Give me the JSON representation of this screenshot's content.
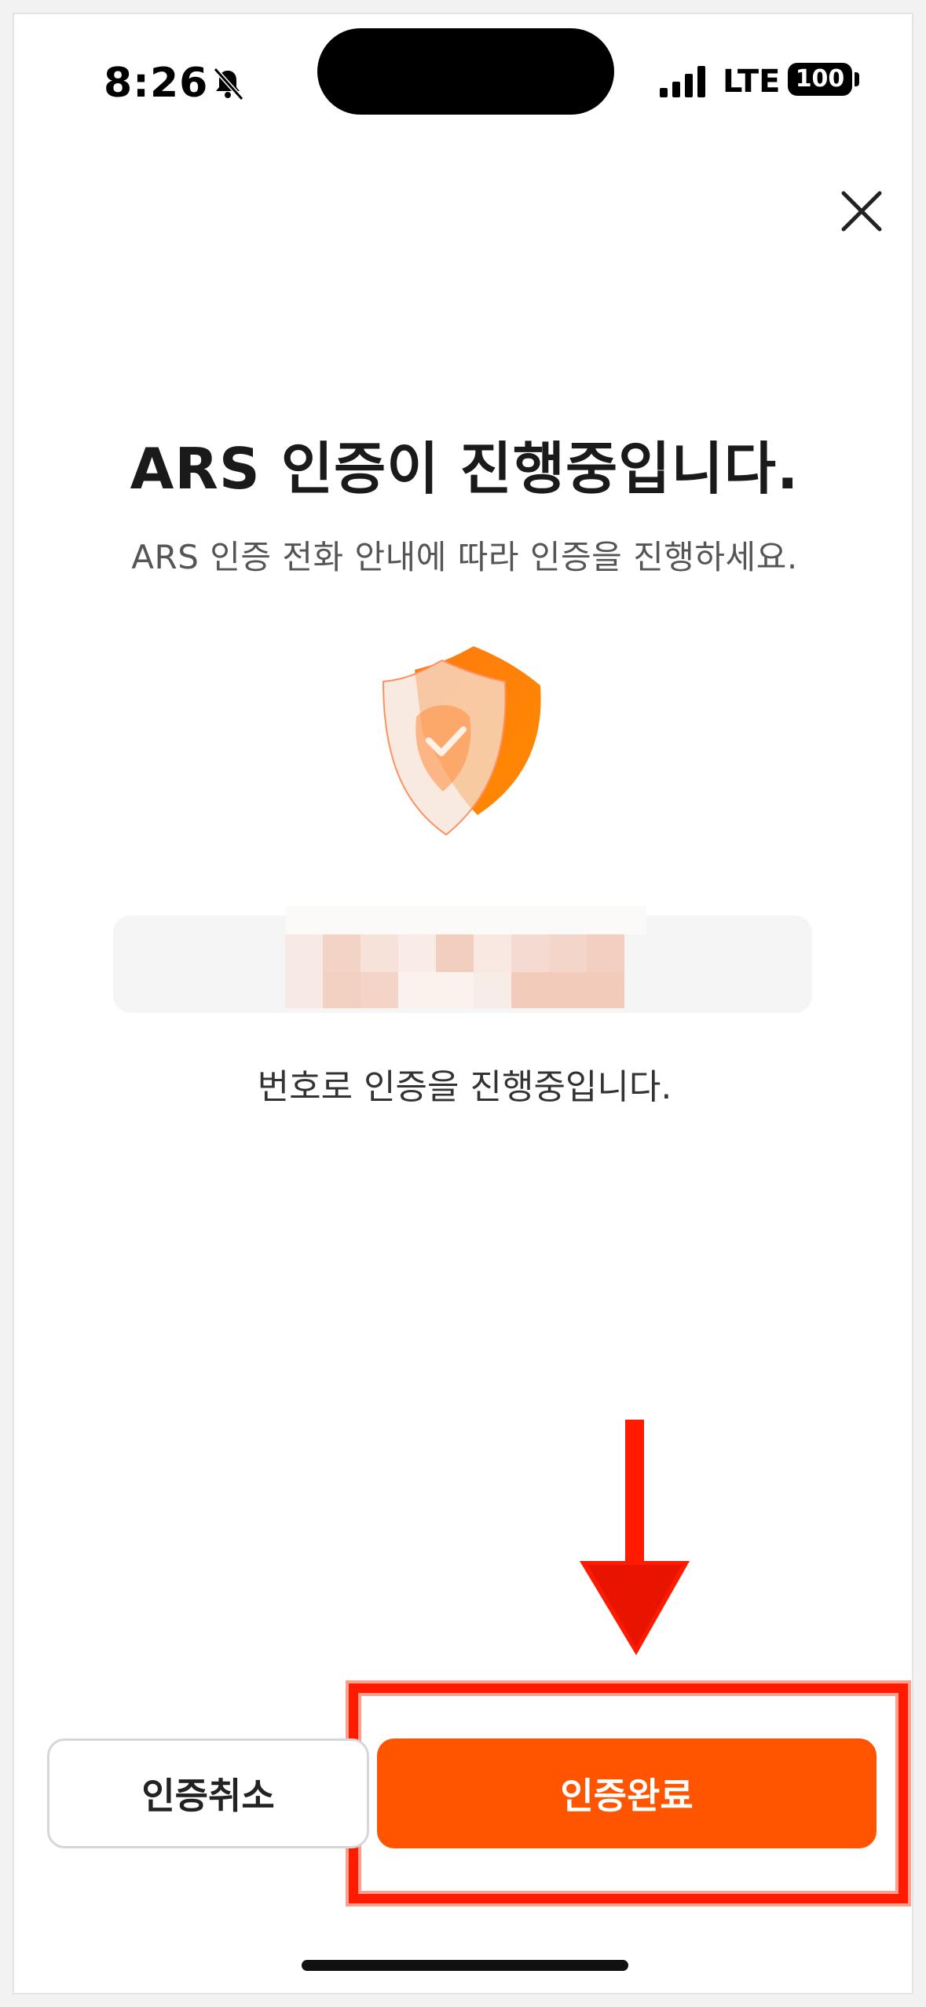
{
  "status_bar": {
    "time": "8:26",
    "network": "LTE",
    "battery": "100",
    "icons": [
      "bell-muted-icon",
      "cellular-signal-icon",
      "battery-icon"
    ]
  },
  "header": {
    "close_icon": "close-icon"
  },
  "main": {
    "title": "ARS 인증이 진행중입니다.",
    "subtitle": "ARS 인증 전화 안내에 따라 인증을 진행하세요.",
    "illustration": "shield-check-icon",
    "status_message": "번호로 인증을 진행중입니다."
  },
  "actions": {
    "cancel_label": "인증취소",
    "confirm_label": "인증완료"
  },
  "colors": {
    "accent": "#ff5500",
    "annotation": "#ff1a00"
  }
}
